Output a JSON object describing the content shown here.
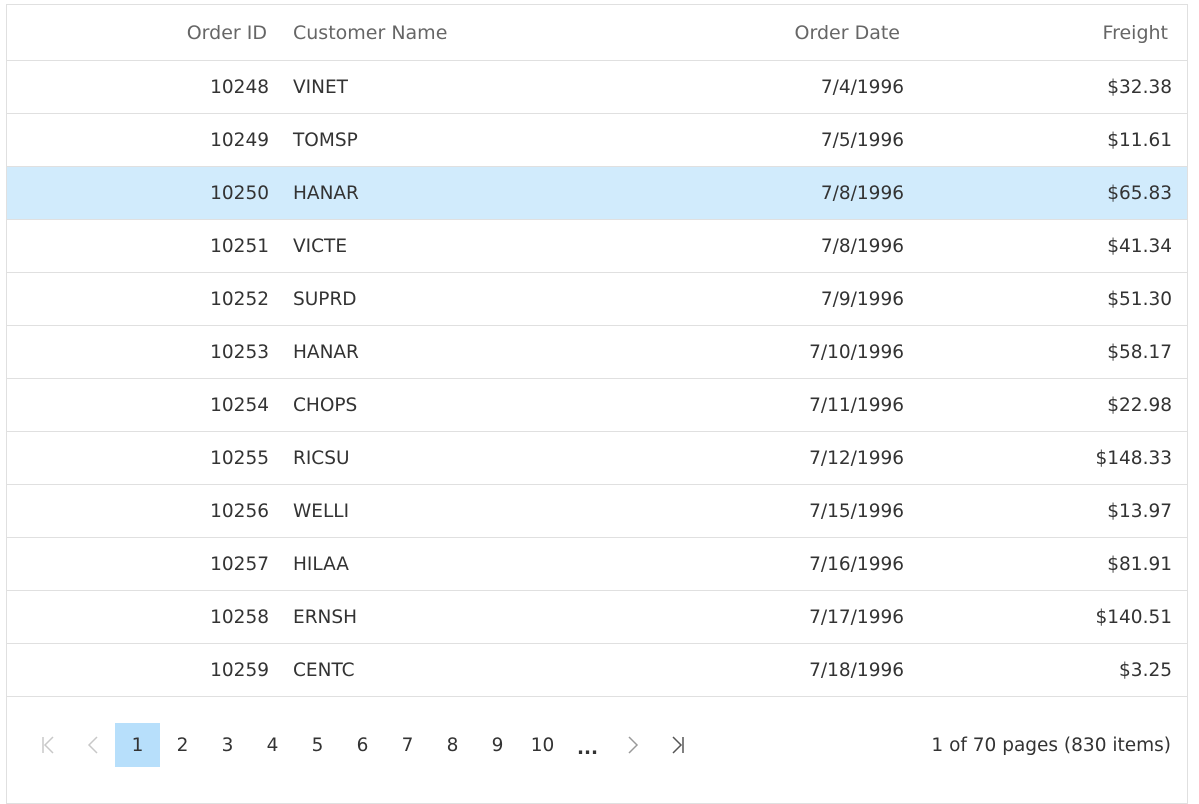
{
  "grid": {
    "headers": {
      "order_id": "Order ID",
      "customer_name": "Customer Name",
      "order_date": "Order Date",
      "freight": "Freight"
    },
    "rows": [
      {
        "order_id": "10248",
        "customer_name": "VINET",
        "order_date": "7/4/1996",
        "freight": "$32.38"
      },
      {
        "order_id": "10249",
        "customer_name": "TOMSP",
        "order_date": "7/5/1996",
        "freight": "$11.61"
      },
      {
        "order_id": "10250",
        "customer_name": "HANAR",
        "order_date": "7/8/1996",
        "freight": "$65.83"
      },
      {
        "order_id": "10251",
        "customer_name": "VICTE",
        "order_date": "7/8/1996",
        "freight": "$41.34"
      },
      {
        "order_id": "10252",
        "customer_name": "SUPRD",
        "order_date": "7/9/1996",
        "freight": "$51.30"
      },
      {
        "order_id": "10253",
        "customer_name": "HANAR",
        "order_date": "7/10/1996",
        "freight": "$58.17"
      },
      {
        "order_id": "10254",
        "customer_name": "CHOPS",
        "order_date": "7/11/1996",
        "freight": "$22.98"
      },
      {
        "order_id": "10255",
        "customer_name": "RICSU",
        "order_date": "7/12/1996",
        "freight": "$148.33"
      },
      {
        "order_id": "10256",
        "customer_name": "WELLI",
        "order_date": "7/15/1996",
        "freight": "$13.97"
      },
      {
        "order_id": "10257",
        "customer_name": "HILAA",
        "order_date": "7/16/1996",
        "freight": "$81.91"
      },
      {
        "order_id": "10258",
        "customer_name": "ERNSH",
        "order_date": "7/17/1996",
        "freight": "$140.51"
      },
      {
        "order_id": "10259",
        "customer_name": "CENTC",
        "order_date": "7/18/1996",
        "freight": "$3.25"
      }
    ],
    "selected_row_index": 2
  },
  "pager": {
    "pages": [
      "1",
      "2",
      "3",
      "4",
      "5",
      "6",
      "7",
      "8",
      "9",
      "10"
    ],
    "current_page": "1",
    "ellipsis": "...",
    "info": "1 of 70 pages (830 items)"
  },
  "colors": {
    "selected_row": "#d1ebfc",
    "active_page": "#b7dffb",
    "border": "#e0e0e0"
  },
  "icons": {
    "first": "first-page-icon",
    "prev": "previous-page-icon",
    "next": "next-page-icon",
    "last": "last-page-icon"
  }
}
